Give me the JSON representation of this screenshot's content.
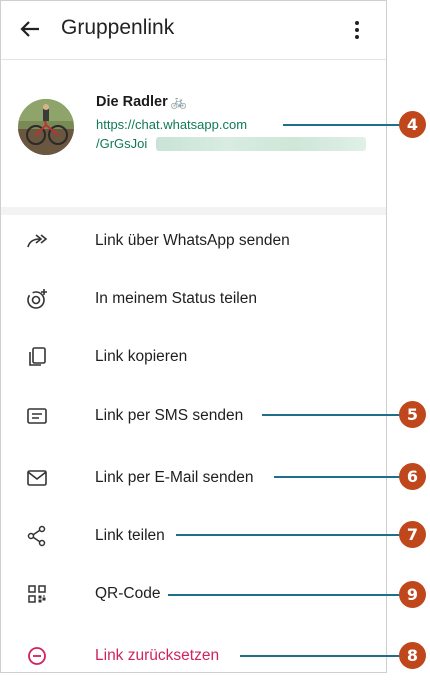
{
  "header": {
    "title": "Gruppenlink"
  },
  "group": {
    "name": "Die Radler",
    "emoji": "🚲",
    "link_line1": "https://chat.whatsapp.com",
    "link_line2": "/GrGsJoi"
  },
  "menu": [
    {
      "label": "Link über WhatsApp senden",
      "icon": "forward-icon"
    },
    {
      "label": "In meinem Status teilen",
      "icon": "status-icon"
    },
    {
      "label": "Link kopieren",
      "icon": "copy-icon"
    },
    {
      "label": "Link per SMS senden",
      "icon": "sms-icon"
    },
    {
      "label": "Link per E-Mail senden",
      "icon": "mail-icon"
    },
    {
      "label": "Link teilen",
      "icon": "share-icon"
    },
    {
      "label": "QR-Code",
      "icon": "qr-code-icon"
    },
    {
      "label": "Link zurücksetzen",
      "icon": "reset-icon"
    }
  ],
  "callouts": [
    "4",
    "5",
    "6",
    "7",
    "9",
    "8"
  ],
  "colors": {
    "accent_link": "#0f7a55",
    "danger": "#d0245a",
    "callout_badge": "#c0471c",
    "callout_line": "#1f6f8b"
  }
}
